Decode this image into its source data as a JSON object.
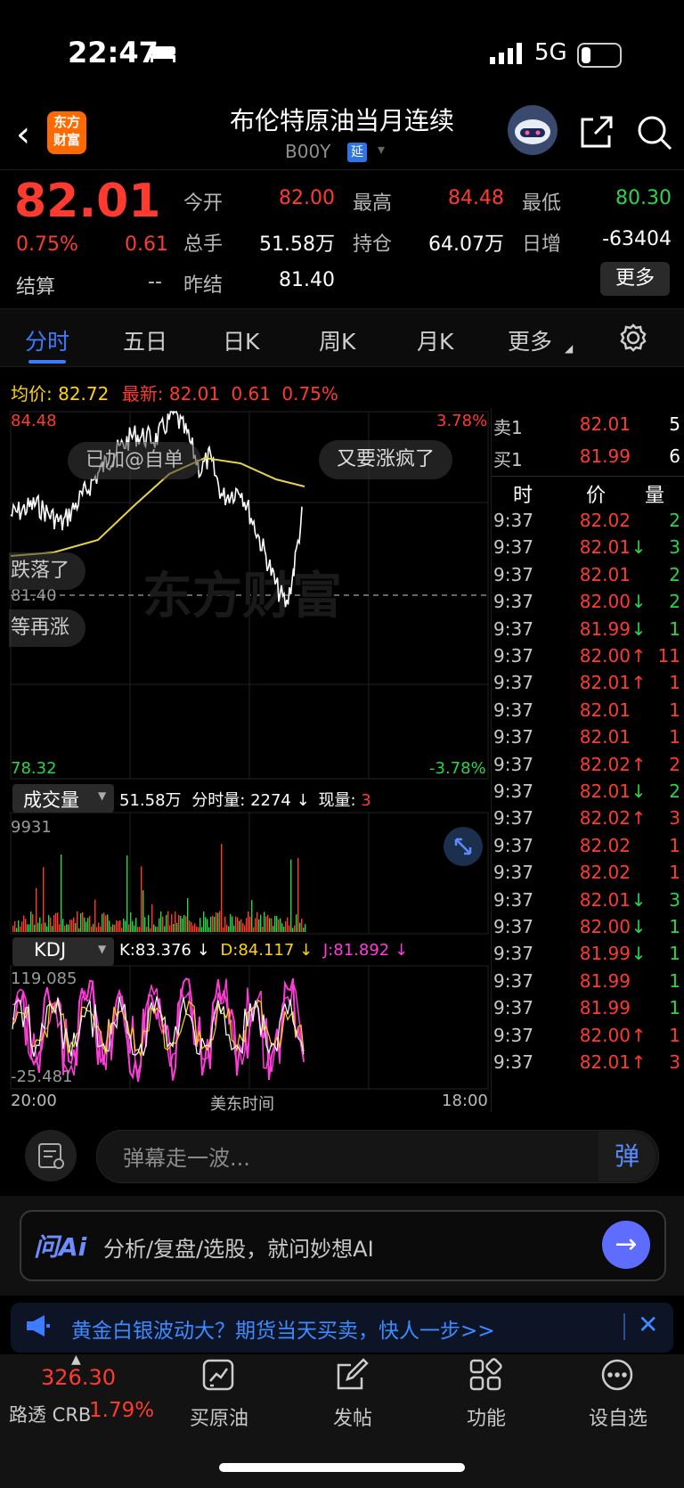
{
  "status_bar": {
    "time": "22:47",
    "network": "5G"
  },
  "header": {
    "logo": "东方财富",
    "title": "布伦特原油当月连续",
    "code": "B00Y",
    "badge": "延",
    "icons": [
      "back-arrow-icon",
      "robot-avatar-icon",
      "share-icon",
      "search-icon"
    ]
  },
  "quote": {
    "price": "82.01",
    "change_pct": "0.75%",
    "change": "0.61",
    "settle_label": "结算",
    "settle_value": "--",
    "fields": [
      {
        "label": "今开",
        "value": "82.00",
        "color": "#ff3b30"
      },
      {
        "label": "最高",
        "value": "84.48",
        "color": "#ff3b30"
      },
      {
        "label": "最低",
        "value": "80.30",
        "color": "#2bd44a"
      },
      {
        "label": "总手",
        "value": "51.58万",
        "color": "#ffffff"
      },
      {
        "label": "持仓",
        "value": "64.07万",
        "color": "#ffffff"
      },
      {
        "label": "日增",
        "value": "-63404",
        "color": "#ffffff"
      },
      {
        "label": "昨结",
        "value": "81.40",
        "color": "#ffffff"
      }
    ],
    "more": "更多"
  },
  "tabs": [
    "分时",
    "五日",
    "日K",
    "周K",
    "月K",
    "更多"
  ],
  "active_tab": "分时",
  "chart_info": {
    "avg_label": "均价:",
    "avg_value": "82.72",
    "latest_label": "最新:",
    "latest_value": "82.01",
    "latest_change": "0.61",
    "latest_pct": "0.75%",
    "y_max": "84.48",
    "y_min": "78.32",
    "pct_max": "3.78%",
    "pct_min": "-3.78%",
    "prev_close": "81.40",
    "bubbles": [
      "已加@自单",
      "又要涨疯了",
      "跌落了",
      "等再涨"
    ],
    "watermark": "东方财富"
  },
  "volume": {
    "label": "成交量",
    "total": "51.58万",
    "segment_label": "分时量:",
    "segment_value": "2274",
    "current_label": "现量:",
    "current_value": "3",
    "max": "9931"
  },
  "kdj": {
    "label": "KDJ",
    "k": "K:83.376",
    "d": "D:84.117",
    "j": "J:81.892",
    "max": "119.085",
    "min": "-25.481"
  },
  "x_axis": {
    "start": "20:00",
    "middle": "美东时间",
    "end": "18:00"
  },
  "order_book": [
    {
      "label": "卖1",
      "price": "82.01",
      "qty": "5"
    },
    {
      "label": "买1",
      "price": "81.99",
      "qty": "6"
    }
  ],
  "trade_header": {
    "time": "时",
    "price": "价",
    "qty": "量"
  },
  "trades": [
    {
      "time": "9:37",
      "price": "82.02",
      "arrow": "",
      "qty": "2",
      "qcolor": "#2bd44a"
    },
    {
      "time": "9:37",
      "price": "82.01",
      "arrow": "↓",
      "qty": "3",
      "qcolor": "#2bd44a"
    },
    {
      "time": "9:37",
      "price": "82.01",
      "arrow": "",
      "qty": "2",
      "qcolor": "#2bd44a"
    },
    {
      "time": "9:37",
      "price": "82.00",
      "arrow": "↓",
      "qty": "2",
      "qcolor": "#2bd44a"
    },
    {
      "time": "9:37",
      "price": "81.99",
      "arrow": "↓",
      "qty": "1",
      "qcolor": "#2bd44a"
    },
    {
      "time": "9:37",
      "price": "82.00",
      "arrow": "↑",
      "qty": "11",
      "qcolor": "#ff3b30"
    },
    {
      "time": "9:37",
      "price": "82.01",
      "arrow": "↑",
      "qty": "1",
      "qcolor": "#ff3b30"
    },
    {
      "time": "9:37",
      "price": "82.01",
      "arrow": "",
      "qty": "1",
      "qcolor": "#ff3b30"
    },
    {
      "time": "9:37",
      "price": "82.01",
      "arrow": "",
      "qty": "1",
      "qcolor": "#ff3b30"
    },
    {
      "time": "9:37",
      "price": "82.02",
      "arrow": "↑",
      "qty": "2",
      "qcolor": "#ff3b30"
    },
    {
      "time": "9:37",
      "price": "82.01",
      "arrow": "↓",
      "qty": "2",
      "qcolor": "#2bd44a"
    },
    {
      "time": "9:37",
      "price": "82.02",
      "arrow": "↑",
      "qty": "3",
      "qcolor": "#ff3b30"
    },
    {
      "time": "9:37",
      "price": "82.02",
      "arrow": "",
      "qty": "1",
      "qcolor": "#ff3b30"
    },
    {
      "time": "9:37",
      "price": "82.02",
      "arrow": "",
      "qty": "1",
      "qcolor": "#ff3b30"
    },
    {
      "time": "9:37",
      "price": "82.01",
      "arrow": "↓",
      "qty": "3",
      "qcolor": "#2bd44a"
    },
    {
      "time": "9:37",
      "price": "82.00",
      "arrow": "↓",
      "qty": "1",
      "qcolor": "#2bd44a"
    },
    {
      "time": "9:37",
      "price": "81.99",
      "arrow": "↓",
      "qty": "1",
      "qcolor": "#2bd44a"
    },
    {
      "time": "9:37",
      "price": "81.99",
      "arrow": "",
      "qty": "1",
      "qcolor": "#2bd44a"
    },
    {
      "time": "9:37",
      "price": "81.99",
      "arrow": "",
      "qty": "1",
      "qcolor": "#2bd44a"
    },
    {
      "time": "9:37",
      "price": "82.00",
      "arrow": "↑",
      "qty": "1",
      "qcolor": "#ff3b30"
    },
    {
      "time": "9:37",
      "price": "82.01",
      "arrow": "↑",
      "qty": "3",
      "qcolor": "#ff3b30"
    }
  ],
  "danmu": {
    "placeholder": "弹幕走一波...",
    "button": "弹"
  },
  "ai_bar": {
    "logo": "问Ai",
    "text": "分析/复盘/选股，就问妙想AI"
  },
  "promo": {
    "text": "黄金白银波动大？期货当天买卖，快人一步>>"
  },
  "bottom_nav": {
    "crb_value": "326.30",
    "crb_name": "路透 CRB",
    "crb_pct": "1.79%",
    "items": [
      "买原油",
      "发帖",
      "功能",
      "设自选"
    ]
  },
  "colors": {
    "up": "#ff3b30",
    "down": "#2bd44a",
    "avg": "#ffd400",
    "accent": "#3b7cff"
  }
}
